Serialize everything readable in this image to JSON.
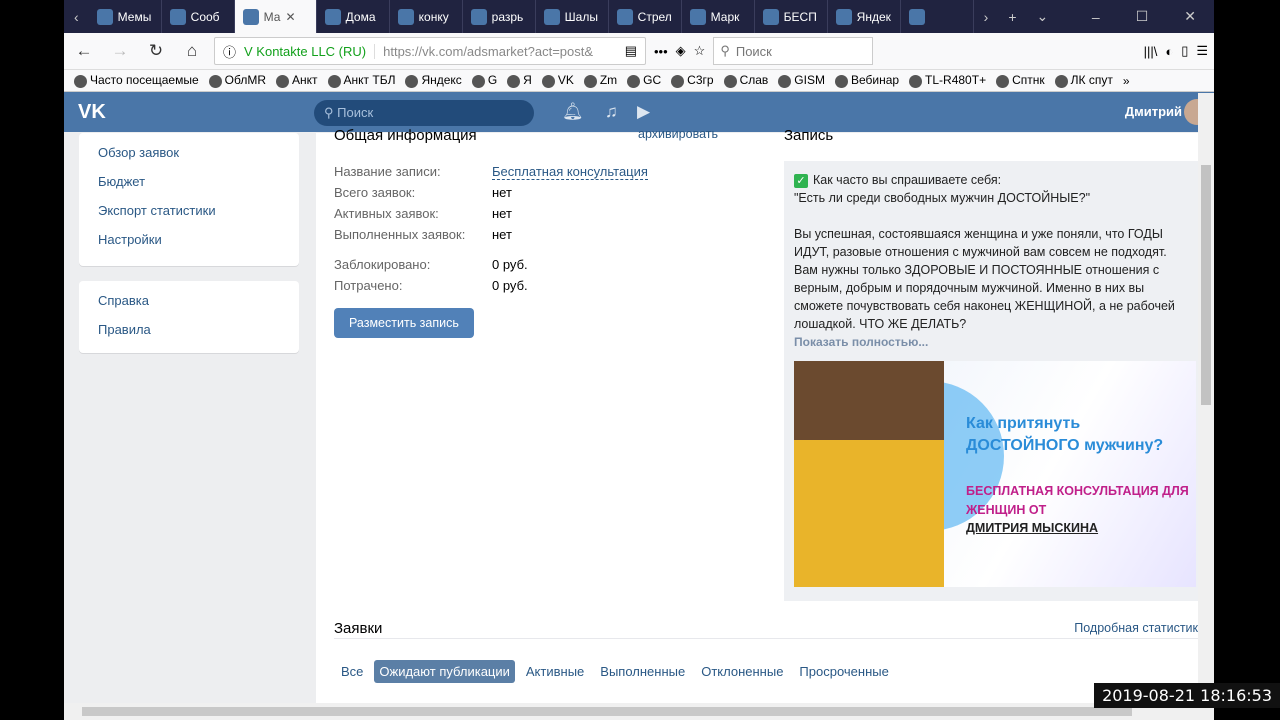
{
  "tabs": [
    "Мемы",
    "Сооб",
    "Ма",
    "Дома",
    "конку",
    "разрь",
    "Шалы",
    "Стрел",
    "Марк",
    "БЕСП",
    "Яндек",
    ""
  ],
  "nav": {
    "identity": "V Kontakte LLC (RU)",
    "url": "https://vk.com/adsmarket?act=post&",
    "search_placeholder": "Поиск"
  },
  "bookmarks": [
    "Часто посещаемые",
    "ОблMR",
    "Анкт",
    "Анкт ТБЛ",
    "Яндекс",
    "G",
    "Я",
    "VK",
    "Zm",
    "GC",
    "С3гр",
    "Слав",
    "GISM",
    "Вебинар",
    "TL-R480T+",
    "Сптнк",
    "ЛК спут"
  ],
  "vk": {
    "logo": "VK",
    "search": "Поиск",
    "user": "Дмитрий"
  },
  "menu1": [
    "Обзор заявок",
    "Бюджет",
    "Экспорт статистики",
    "Настройки"
  ],
  "menu2": [
    "Справка",
    "Правила"
  ],
  "info": {
    "title": "Общая информация",
    "archive": "архивировать",
    "rows": [
      {
        "k": "Название записи:",
        "v": "Бесплатная консультация"
      },
      {
        "k": "Всего заявок:",
        "v": "нет"
      },
      {
        "k": "Активных заявок:",
        "v": "нет"
      },
      {
        "k": "Выполненных заявок:",
        "v": "нет"
      }
    ],
    "rows2": [
      {
        "k": "Заблокировано:",
        "v": "0 руб."
      },
      {
        "k": "Потрачено:",
        "v": "0 руб."
      }
    ],
    "button": "Разместить запись"
  },
  "post": {
    "title": "Запись",
    "line1": "Как часто вы спрашиваете себя:",
    "line2": "\"Есть ли среди свободных мужчин ДОСТОЙНЫЕ?\"",
    "body": "Вы успешная, состоявшаяся женщина и уже поняли, что ГОДЫ ИДУТ, разовые отношения с мужчиной вам совсем не подходят. Вам нужны только ЗДОРОВЫЕ И ПОСТОЯННЫЕ отношения с верным, добрым и порядочным мужчиной. Именно в них вы сможете почувствовать себя наконец ЖЕНЩИНОЙ, а не рабочей лошадкой. ЧТО ЖЕ ДЕЛАТЬ?",
    "more": "Показать полностью...",
    "img_title": "Как притянуть ДОСТОЙНОГО мужчину?",
    "img_sub": "БЕСПЛАТНАЯ КОНСУЛЬТАЦИЯ ДЛЯ ЖЕНЩИН ОТ",
    "img_name": "ДМИТРИЯ МЫСКИНА"
  },
  "requests": {
    "title": "Заявки",
    "stats": "Подробная статистик",
    "tabs": [
      "Все",
      "Ожидают публикации",
      "Активные",
      "Выполненные",
      "Отклоненные",
      "Просроченные"
    ],
    "active": 1
  },
  "timestamp": "2019-08-21  18:16:53"
}
